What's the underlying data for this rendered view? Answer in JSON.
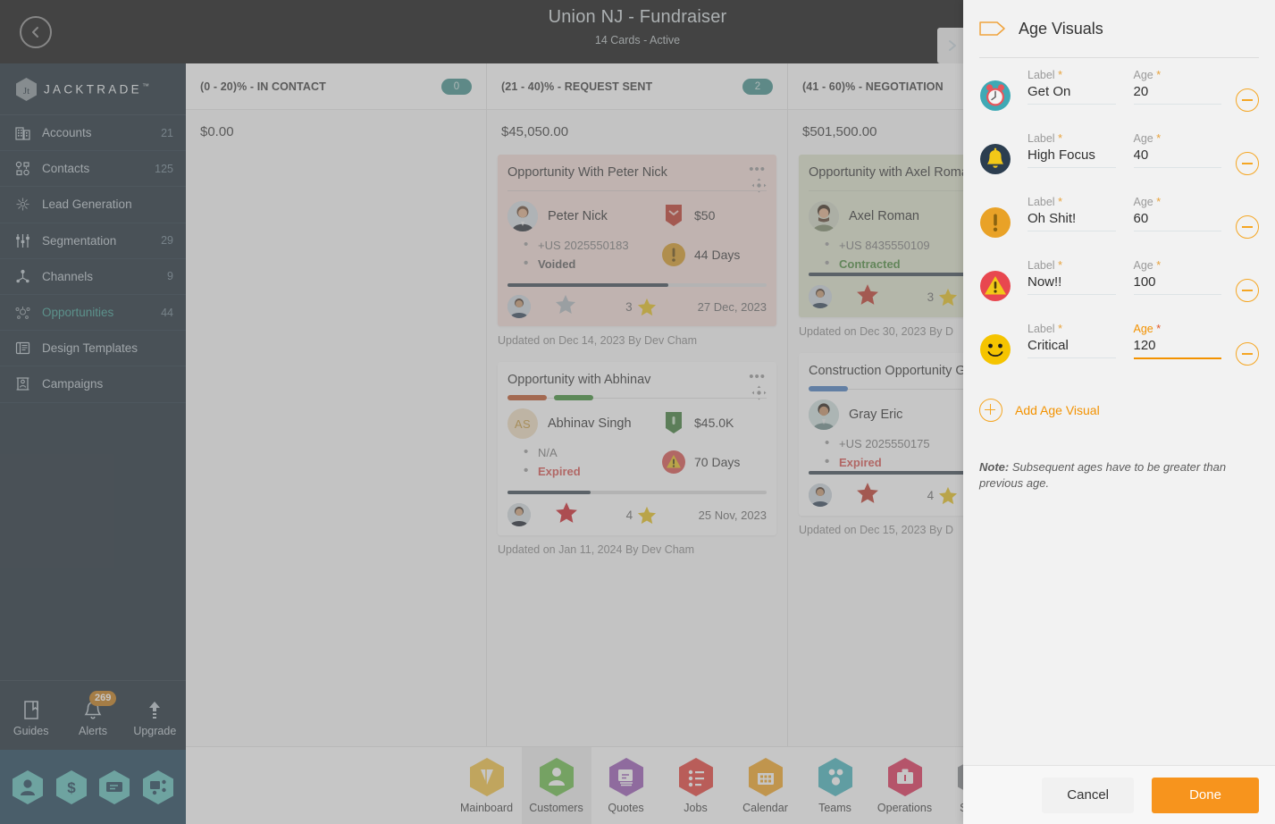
{
  "header": {
    "title": "Union NJ - Fundraiser",
    "subtitle": "14 Cards - Active",
    "back_icon": "chevron-left-icon",
    "next_icon": "chevron-right-icon"
  },
  "sidebar": {
    "brand": "JACKTRADE",
    "brand_tm": "™",
    "items": [
      {
        "label": "Accounts",
        "count": "21",
        "icon": "building-icon",
        "active": false
      },
      {
        "label": "Contacts",
        "count": "125",
        "icon": "contacts-icon",
        "active": false
      },
      {
        "label": "Lead Generation",
        "count": "",
        "icon": "lead-generation-icon",
        "active": false
      },
      {
        "label": "Segmentation",
        "count": "29",
        "icon": "segmentation-icon",
        "active": false
      },
      {
        "label": "Channels",
        "count": "9",
        "icon": "channels-icon",
        "active": false
      },
      {
        "label": "Opportunities",
        "count": "44",
        "icon": "opportunities-icon",
        "active": true
      },
      {
        "label": "Design Templates",
        "count": "",
        "icon": "design-templates-icon",
        "active": false
      },
      {
        "label": "Campaigns",
        "count": "",
        "icon": "campaigns-icon",
        "active": false
      }
    ],
    "tools": [
      {
        "label": "Guides",
        "icon": "book-icon",
        "badge": ""
      },
      {
        "label": "Alerts",
        "icon": "bell-icon",
        "badge": "269"
      },
      {
        "label": "Upgrade",
        "icon": "arrow-up-icon",
        "badge": ""
      }
    ],
    "quick_icons": [
      "person-icon",
      "dollar-icon",
      "payment-icon",
      "network-icon"
    ]
  },
  "board": {
    "columns": [
      {
        "title": "(0 - 20)% - IN CONTACT",
        "badge": "0",
        "total": "$0.00",
        "cards": []
      },
      {
        "title": "(21 - 40)% - REQUEST SENT",
        "badge": "2",
        "total": "$45,050.00",
        "cards": [
          {
            "theme": "pink",
            "title": "Opportunity With Peter Nick",
            "tags": [],
            "person": "Peter Nick",
            "avatar_type": "photo",
            "avatar_initials": "",
            "phone": "+US 2025550183",
            "status": "Voided",
            "status_style": "bold",
            "amount": "$50",
            "amount_icon": "shield-red-icon",
            "days": "44 Days",
            "days_icon": "exclamation-circle-orange-icon",
            "progress": 62,
            "star_left": "star-gray-icon",
            "star_right_count": "3",
            "star_right": "star-yellow-icon",
            "date": "27 Dec, 2023",
            "updated": "Updated on Dec 14, 2023 By Dev Cham"
          },
          {
            "theme": "gray",
            "title": "Opportunity with Abhinav",
            "tags": [
              "#c0562a",
              "#3f8e37"
            ],
            "person": "Abhinav Singh",
            "avatar_type": "initials",
            "avatar_initials": "AS",
            "phone": "N/A",
            "status": "Expired",
            "status_style": "red",
            "amount": "$45.0K",
            "amount_icon": "shield-green-icon",
            "days": "70 Days",
            "days_icon": "warning-triangle-red-icon",
            "progress": 32,
            "star_left": "star-red-icon",
            "star_right_count": "4",
            "star_right": "star-yellow-icon",
            "date": "25 Nov, 2023",
            "updated": "Updated on Jan 11, 2024 By Dev Cham"
          }
        ]
      },
      {
        "title": "(41 - 60)% - NEGOTIATION",
        "badge": "",
        "total": "$501,500.00",
        "cards": [
          {
            "theme": "olive",
            "title": "Opportunity with Axel Roman",
            "tags": [],
            "person": "Axel Roman",
            "avatar_type": "photo",
            "avatar_initials": "",
            "phone": "+US 8435550109",
            "status": "Contracted",
            "status_style": "green",
            "amount": "",
            "amount_icon": "",
            "days": "",
            "days_icon": "",
            "progress": 96,
            "star_left": "star-red-icon",
            "star_right_count": "3",
            "star_right": "star-yellow-icon",
            "date": "",
            "updated": "Updated on Dec 30, 2023 By D"
          },
          {
            "theme": "gray",
            "title": "Construction Opportunity Gray Eric",
            "tags": [
              "#4a7fc1"
            ],
            "person": "Gray Eric",
            "avatar_type": "photo",
            "avatar_initials": "",
            "phone": "+US 2025550175",
            "status": "Expired",
            "status_style": "red",
            "amount": "",
            "amount_icon": "",
            "days": "",
            "days_icon": "",
            "progress": 88,
            "star_left": "star-red-icon",
            "star_right_count": "4",
            "star_right": "star-yellow-icon",
            "date": "",
            "updated": "Updated on Dec 15, 2023 By D"
          }
        ]
      }
    ]
  },
  "bottom_nav": {
    "items": [
      {
        "label": "Mainboard",
        "icon": "mainboard-icon",
        "color": "#f5c342",
        "selected": false
      },
      {
        "label": "Customers",
        "icon": "customers-icon",
        "color": "#6cbe4b",
        "selected": true
      },
      {
        "label": "Quotes",
        "icon": "quotes-icon",
        "color": "#9b59b6",
        "selected": false
      },
      {
        "label": "Jobs",
        "icon": "jobs-icon",
        "color": "#e8413a",
        "selected": false
      },
      {
        "label": "Calendar",
        "icon": "calendar-icon",
        "color": "#f5a623",
        "selected": false
      },
      {
        "label": "Teams",
        "icon": "teams-icon",
        "color": "#45b5bd",
        "selected": false
      },
      {
        "label": "Operations",
        "icon": "operations-icon",
        "color": "#e03158",
        "selected": false
      },
      {
        "label": "Setup",
        "icon": "setup-icon",
        "color": "#8b8f93",
        "selected": false
      }
    ],
    "avatar": "user-avatar"
  },
  "panel": {
    "title": "Age Visuals",
    "tag_icon": "tag-outline-icon",
    "label_caption": "Label",
    "age_caption": "Age",
    "required_mark": "*",
    "rows": [
      {
        "icon": "alarm-clock-icon",
        "label": "Get On",
        "age": "20",
        "focused": false
      },
      {
        "icon": "bell-icon",
        "label": "High Focus",
        "age": "40",
        "focused": false
      },
      {
        "icon": "exclamation-circle-icon",
        "label": "Oh Shit!",
        "age": "60",
        "focused": false
      },
      {
        "icon": "warning-triangle-icon",
        "label": "Now!!",
        "age": "100",
        "focused": false
      },
      {
        "icon": "smiley-icon",
        "label": "Critical",
        "age": "120",
        "focused": true
      }
    ],
    "add_label": "Add Age Visual",
    "add_icon": "plus-circle-icon",
    "remove_icon": "minus-circle-icon",
    "note_prefix": "Note:",
    "note_text": " Subsequent ages have to be greater than previous age.",
    "cancel_label": "Cancel",
    "done_label": "Done",
    "accent_color": "#f7941d"
  }
}
